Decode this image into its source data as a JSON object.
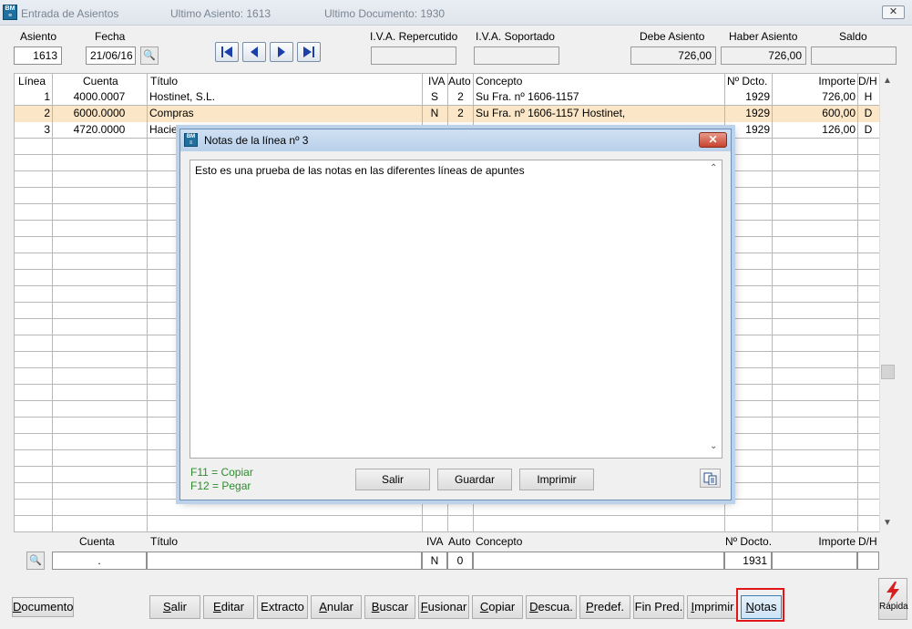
{
  "window": {
    "title": "Entrada de Asientos",
    "ultimo_asiento": "Ultimo Asiento: 1613",
    "ultimo_documento": "Ultimo Documento: 1930",
    "icon": "bm-app-icon",
    "close_glyph": "✕"
  },
  "header": {
    "asiento_label": "Asiento",
    "asiento_value": "1613",
    "fecha_label": "Fecha",
    "fecha_value": "21/06/16",
    "iva_rep_label": "I.V.A. Repercutido",
    "iva_rep_value": "",
    "iva_sop_label": "I.V.A. Soportado",
    "iva_sop_value": "",
    "debe_label": "Debe Asiento",
    "debe_value": "726,00",
    "haber_label": "Haber Asiento",
    "haber_value": "726,00",
    "saldo_label": "Saldo",
    "saldo_value": ""
  },
  "grid": {
    "columns": {
      "linea": "Línea",
      "cuenta": "Cuenta",
      "titulo": "Título",
      "iva": "IVA",
      "auto": "Auto",
      "concepto": "Concepto",
      "dcto": "Nº Dcto.",
      "importe": "Importe",
      "dh": "D/H"
    },
    "rows": [
      {
        "linea": "1",
        "cuenta": "4000.0007",
        "titulo": "Hostinet, S.L.",
        "iva": "S",
        "auto": "2",
        "concepto": "Su Fra. nº 1606-1157",
        "dcto": "1929",
        "importe": "726,00",
        "dh": "H"
      },
      {
        "linea": "2",
        "cuenta": "6000.0000",
        "titulo": "Compras",
        "iva": "N",
        "auto": "2",
        "concepto": "Su Fra. nº 1606-1157 Hostinet,",
        "dcto": "1929",
        "importe": "600,00",
        "dh": "D"
      },
      {
        "linea": "3",
        "cuenta": "4720.0000",
        "titulo": "Hacien",
        "iva": "",
        "auto": "",
        "concepto": "",
        "dcto": "1929",
        "importe": "126,00",
        "dh": "D"
      }
    ]
  },
  "entry": {
    "cuenta_label": "Cuenta",
    "titulo_label": "Título",
    "iva_label": "IVA",
    "auto_label": "Auto",
    "concepto_label": "Concepto",
    "dcto_label": "Nº Docto.",
    "importe_label": "Importe",
    "dh_label": "D/H",
    "cuenta_value": ".",
    "titulo_value": "",
    "iva_value": "N",
    "auto_value": "0",
    "concepto_value": "",
    "dcto_value": "1931",
    "importe_value": "",
    "dh_value": ""
  },
  "dialog": {
    "title": "Notas de la línea nº 3",
    "text": "Esto es una prueba de las notas en las diferentes líneas de apuntes",
    "hint_copy": "F11 = Copiar",
    "hint_paste": "F12 = Pegar",
    "btn_salir": "Salir",
    "btn_guardar": "Guardar",
    "btn_imprimir": "Imprimir"
  },
  "toolbar": {
    "documento": "Documento",
    "salir": "Salir",
    "editar": "Editar",
    "extracto": "Extracto",
    "anular": "Anular",
    "buscar": "Buscar",
    "fusionar": "Fusionar",
    "copiar": "Copiar",
    "descua": "Descua.",
    "predef": "Predef.",
    "fin_pred": "Fin Pred.",
    "imprimir": "Imprimir",
    "notas": "Notas",
    "rapida": "Rápida"
  },
  "colors": {
    "selected_row": "#fbe7c8",
    "highlight": "#e0161b",
    "hint_green": "#2d8b2d",
    "dialog_border": "#6d8fb5"
  }
}
